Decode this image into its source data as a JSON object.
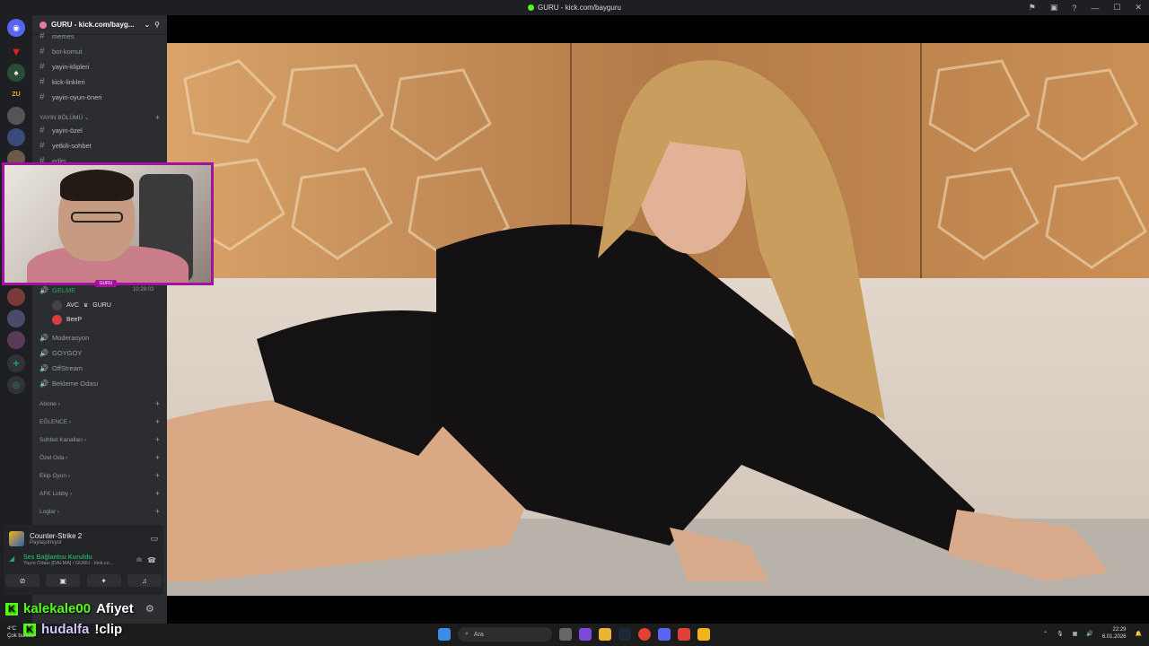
{
  "window": {
    "title": "GURU - kick.com/bayguru"
  },
  "titlebar_icons": [
    "flag-icon",
    "inbox-icon",
    "help-icon",
    "minimize-icon",
    "maximize-icon",
    "close-icon"
  ],
  "server": {
    "name": "GURU - kick.com/bayg..."
  },
  "channels_top": [
    {
      "name": "memes"
    },
    {
      "name": "bot-komut"
    },
    {
      "name": "yayin-klipleri"
    },
    {
      "name": "kick-linkleri"
    },
    {
      "name": "yayin-oyun-öneri"
    }
  ],
  "category_yayin": {
    "label": "YAYIN BÖLÜMÜ"
  },
  "channels_yayin": [
    {
      "name": "yayin-özel"
    },
    {
      "name": "yetkili-sohbet"
    },
    {
      "name": "edits"
    }
  ],
  "voice": {
    "channel": "GELME",
    "time": "10:28:03",
    "users": [
      {
        "name": "AVC"
      },
      {
        "name": "GURU"
      },
      {
        "name": "BeeP"
      }
    ]
  },
  "voice_channels": [
    {
      "name": "Moderasyon"
    },
    {
      "name": "GOYGOY"
    },
    {
      "name": "OffStream"
    },
    {
      "name": "Bekleme Odası"
    }
  ],
  "categories": [
    {
      "label": "Abone"
    },
    {
      "label": "EĞLENCE"
    },
    {
      "label": "Sohbet Kanalları"
    },
    {
      "label": "Özel Oda"
    },
    {
      "label": "Ekip Oyun"
    },
    {
      "label": "AFK Lobby"
    },
    {
      "label": "Loglar"
    }
  ],
  "activity": {
    "game": "Counter-Strike 2",
    "status": "Paylaşılmıyor"
  },
  "voice_status": {
    "title": "Ses Bağlantısı Kuruldu",
    "subtitle": "Yayın Odası [DALMA] / GURU - kick.co..."
  },
  "webcam_tag": "GURU",
  "chat": [
    {
      "user": "kalekale00",
      "message": "Afiyet"
    },
    {
      "user": "hudalfa",
      "message": "!clip"
    }
  ],
  "taskbar": {
    "weather_temp": "4°C",
    "weather_desc": "Çok bulutlu",
    "search_placeholder": "Ara",
    "time": "22:29",
    "date": "6.01.2026"
  }
}
